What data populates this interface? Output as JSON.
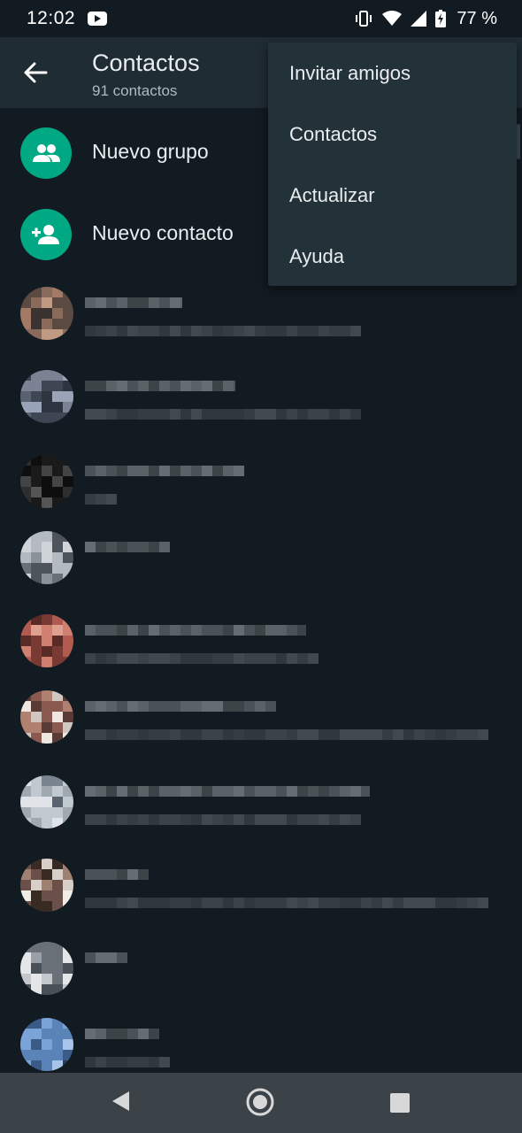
{
  "status_bar": {
    "time": "12:02",
    "battery_percent": "77 %",
    "icons": [
      "youtube-icon",
      "vibrate-icon",
      "wifi-icon",
      "signal-icon",
      "battery-charging-icon"
    ]
  },
  "app_bar": {
    "title": "Contactos",
    "subtitle": "91 contactos"
  },
  "actions": [
    {
      "label": "Nuevo grupo",
      "icon": "group-icon"
    },
    {
      "label": "Nuevo contacto",
      "icon": "add-person-icon"
    }
  ],
  "menu": {
    "items": [
      "Invitar amigos",
      "Contactos",
      "Actualizar",
      "Ayuda"
    ]
  },
  "colors": {
    "background": "#121b22",
    "app_bar": "#1f2c34",
    "accent": "#00a884",
    "menu": "#233138",
    "nav_bar": "#3b4349"
  }
}
